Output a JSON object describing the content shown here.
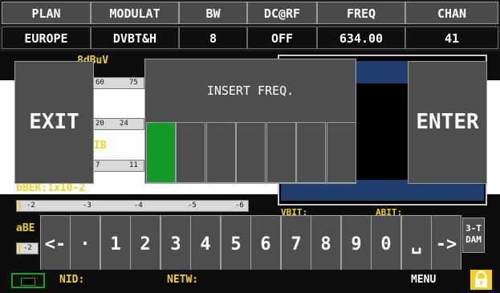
{
  "header": {
    "labels": [
      "PLAN",
      "MODULAT",
      "BW",
      "DC@RF",
      "FREQ",
      "CHAN"
    ],
    "values": [
      "EUROPE",
      "DVBT&H",
      "8",
      "OFF",
      "634.00",
      "41"
    ]
  },
  "background": {
    "power_label": "8dBuV",
    "scale1": [
      "60",
      "75"
    ],
    "scale2": [
      "20",
      "24"
    ],
    "mer_fragment": "IB",
    "scale3": [
      "7",
      "11"
    ],
    "ber_label": "bBER:1x10-2",
    "scale4": [
      "-2",
      "-3",
      "-4",
      "-5",
      "-6"
    ],
    "abe_label": "aBE",
    "abe_scale": "-2",
    "vbit_label": "VBIT:",
    "abit_label": "ABIT:",
    "dvbt_label": "3-T",
    "dvbt_sub": "DAM",
    "nid_label": "NID:",
    "netw_label": "NETW:",
    "menu_label": "MENU"
  },
  "dialog": {
    "exit_label": "EXIT",
    "enter_label": "ENTER",
    "title": "INSERT FREQ.",
    "cells": [
      "",
      "",
      "",
      "",
      "",
      "",
      ""
    ]
  },
  "keypad": {
    "keys": [
      "<-",
      "·",
      "1",
      "2",
      "3",
      "4",
      "5",
      "6",
      "7",
      "8",
      "9",
      "0",
      "␣",
      "->"
    ]
  },
  "colors": {
    "accent_yellow": "#f2d21a",
    "active_cell": "#129a28",
    "button_bg": "#4e4e4e",
    "battery": "#1ba02a"
  },
  "icons": [
    "battery-icon",
    "lock-icon"
  ]
}
